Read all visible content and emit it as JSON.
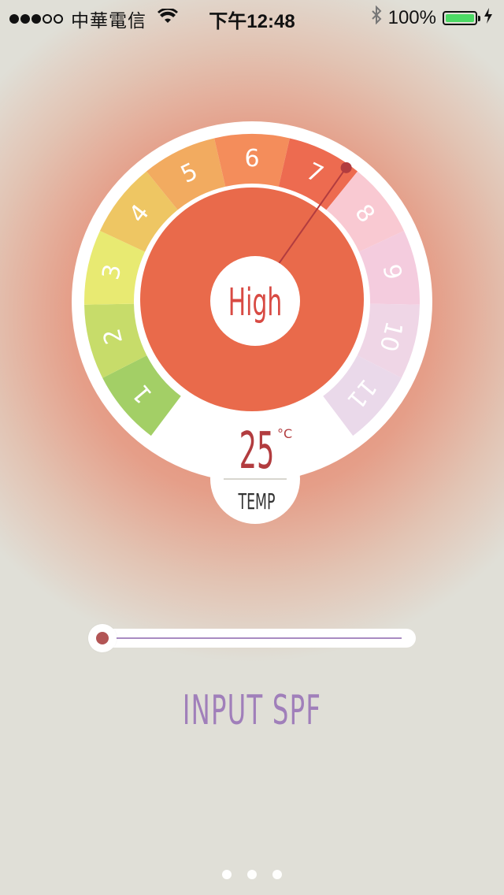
{
  "status_bar": {
    "carrier": "中華電信",
    "time": "下午12:48",
    "battery": "100%"
  },
  "dial": {
    "segments": [
      "1",
      "2",
      "3",
      "4",
      "5",
      "6",
      "7",
      "8",
      "9",
      "10",
      "11"
    ],
    "segment_colors": [
      "#a3cf66",
      "#c7dc6a",
      "#e8ea72",
      "#eec663",
      "#f2ab60",
      "#f48d5b",
      "#ed6b50",
      "#f9c9d2",
      "#f4ccde",
      "#efd6e6",
      "#ead9ea"
    ],
    "selected_segment": 7,
    "level_label": "High",
    "temperature": "25",
    "temperature_unit": "°C",
    "temperature_label": "TEMP",
    "center_color": "#e96a4b",
    "accent_color": "#b23c3f"
  },
  "slider": {
    "value": 0
  },
  "input_title": "INPUT SPF",
  "pager": {
    "pages": 3,
    "current": 1
  }
}
